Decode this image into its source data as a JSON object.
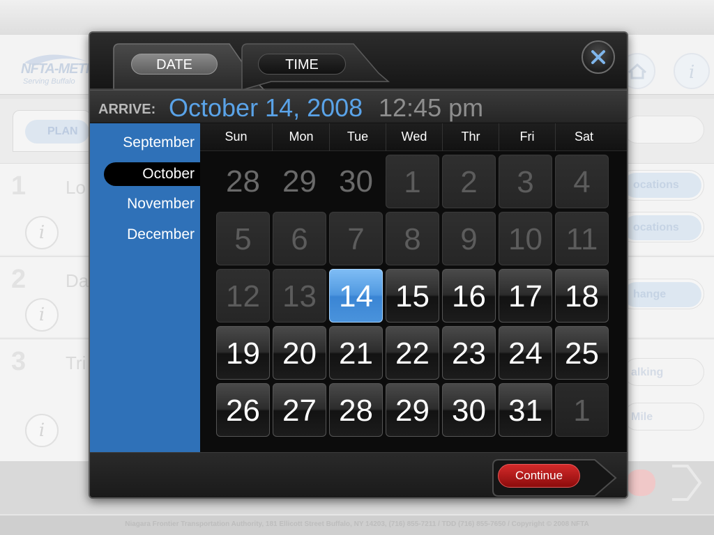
{
  "background": {
    "logo_text": "NFTA-METRO",
    "logo_sub": "Serving Buffalo",
    "tab_label": "PLAN",
    "rows": [
      {
        "num": "1",
        "word": "Lo"
      },
      {
        "num": "2",
        "word": "Da"
      },
      {
        "num": "3",
        "word": "Tri"
      }
    ],
    "right_pills": [
      "ocations",
      "ocations",
      "hange",
      "alking",
      "Mile"
    ],
    "footer": "Niagara Frontier Transportation Authority, 181 Ellicott Street Buffalo, NY 14203, (716) 855-7211 / TDD (716) 855-7650 / Copyright © 2008 NFTA"
  },
  "modal": {
    "tabs": [
      {
        "id": "date",
        "label": "DATE",
        "active": true
      },
      {
        "id": "time",
        "label": "TIME",
        "active": false
      }
    ],
    "close_icon": "close-x-icon",
    "summary": {
      "label": "ARRIVE:",
      "date": "October 14, 2008",
      "time": "12:45 pm"
    },
    "months": [
      {
        "label": "September",
        "selected": false
      },
      {
        "label": "October",
        "selected": true
      },
      {
        "label": "November",
        "selected": false
      },
      {
        "label": "December",
        "selected": false
      }
    ],
    "weekdays": [
      "Sun",
      "Mon",
      "Tue",
      "Wed",
      "Thr",
      "Fri",
      "Sat"
    ],
    "days": [
      {
        "n": "28",
        "state": "dim-out"
      },
      {
        "n": "29",
        "state": "dim-out"
      },
      {
        "n": "30",
        "state": "dim-out"
      },
      {
        "n": "1",
        "state": "past"
      },
      {
        "n": "2",
        "state": "past"
      },
      {
        "n": "3",
        "state": "past"
      },
      {
        "n": "4",
        "state": "past"
      },
      {
        "n": "5",
        "state": "past"
      },
      {
        "n": "6",
        "state": "past"
      },
      {
        "n": "7",
        "state": "past"
      },
      {
        "n": "8",
        "state": "past"
      },
      {
        "n": "9",
        "state": "past"
      },
      {
        "n": "10",
        "state": "past"
      },
      {
        "n": "11",
        "state": "past"
      },
      {
        "n": "12",
        "state": "past"
      },
      {
        "n": "13",
        "state": "past"
      },
      {
        "n": "14",
        "state": "selected"
      },
      {
        "n": "15",
        "state": "future"
      },
      {
        "n": "16",
        "state": "future"
      },
      {
        "n": "17",
        "state": "future"
      },
      {
        "n": "18",
        "state": "future"
      },
      {
        "n": "19",
        "state": "future"
      },
      {
        "n": "20",
        "state": "future"
      },
      {
        "n": "21",
        "state": "future"
      },
      {
        "n": "22",
        "state": "future"
      },
      {
        "n": "23",
        "state": "future"
      },
      {
        "n": "24",
        "state": "future"
      },
      {
        "n": "25",
        "state": "future"
      },
      {
        "n": "26",
        "state": "future"
      },
      {
        "n": "27",
        "state": "future"
      },
      {
        "n": "28",
        "state": "future"
      },
      {
        "n": "29",
        "state": "future"
      },
      {
        "n": "30",
        "state": "future"
      },
      {
        "n": "31",
        "state": "future"
      },
      {
        "n": "1",
        "state": "next-dim"
      }
    ],
    "continue_label": "Continue",
    "colors": {
      "accent_blue": "#5aa3e8",
      "month_panel": "#2f71b8",
      "continue_red": "#b81c1c"
    }
  }
}
